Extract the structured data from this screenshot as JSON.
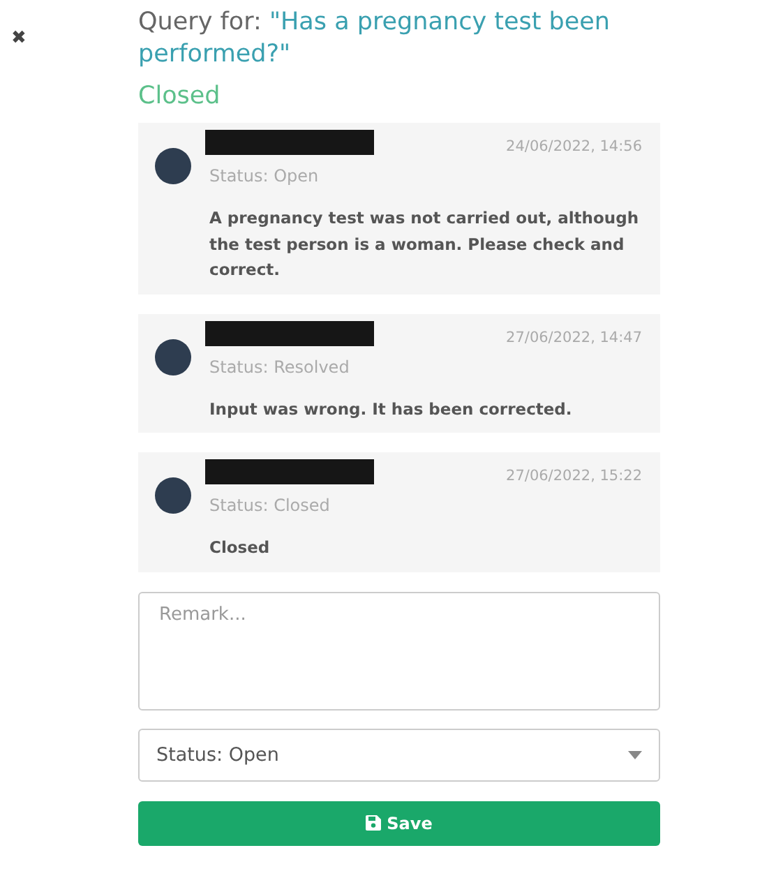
{
  "close_button": "✖",
  "title": {
    "prefix": "Query for: ",
    "question": "\"Has a pregnancy test been performed?\""
  },
  "query_status": "Closed",
  "comments": [
    {
      "author_redacted": true,
      "date": "24/06/2022, 14:56",
      "status": "Status: Open",
      "text": "A pregnancy test was not carried out, although the test person is a woman. Please check and correct."
    },
    {
      "author_redacted": true,
      "date": "27/06/2022, 14:47",
      "status": "Status: Resolved",
      "text": "Input was wrong. It has been corrected."
    },
    {
      "author_redacted": true,
      "date": "27/06/2022, 15:22",
      "status": "Status: Closed",
      "text": "Closed"
    }
  ],
  "remark": {
    "placeholder": "Remark..."
  },
  "status_select": {
    "value": "Status: Open"
  },
  "save_button": "Save"
}
